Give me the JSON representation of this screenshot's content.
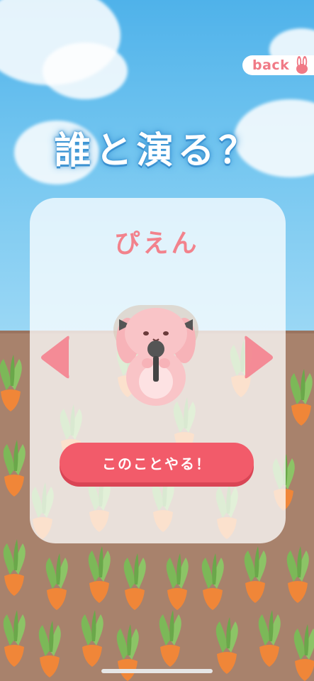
{
  "header": {
    "back_label": "back"
  },
  "title": "誰と演る？",
  "selector": {
    "character_name": "ぴえん",
    "confirm_label": "このことやる！"
  },
  "colors": {
    "accent_pink": "#f2828c",
    "button_red": "#f25b6a",
    "sky_blue": "#4fb2ea",
    "soil_brown": "#a8826c"
  },
  "icons": {
    "back": "bunny-icon",
    "prev": "arrow-left-icon",
    "next": "arrow-right-icon"
  }
}
